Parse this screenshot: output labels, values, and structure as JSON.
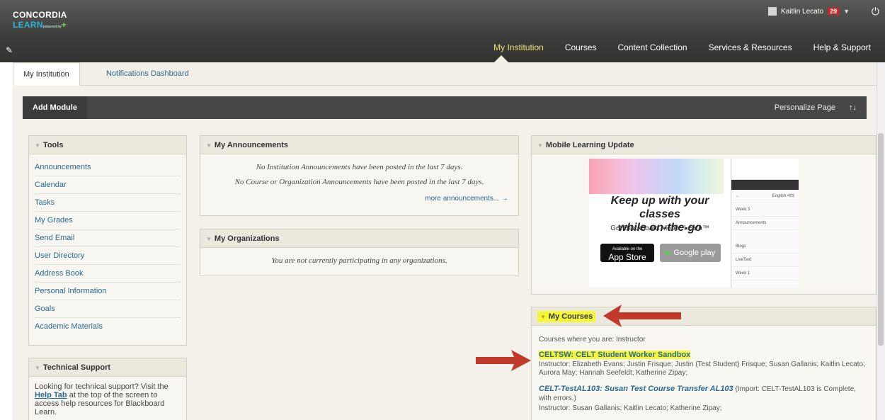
{
  "header": {
    "logo_line1": "CONCORDIA",
    "logo_line2": "LEARN",
    "logo_small": "powered by",
    "user_name": "Kaitlin Lecato",
    "notification_count": "29",
    "nav": [
      "My Institution",
      "Courses",
      "Content Collection",
      "Services & Resources",
      "Help & Support"
    ],
    "active_nav": "My Institution"
  },
  "subtabs": [
    "My Institution",
    "Notifications Dashboard"
  ],
  "module_bar": {
    "add": "Add Module",
    "personalize": "Personalize Page",
    "sort": "↑↓"
  },
  "tools": {
    "title": "Tools",
    "items": [
      "Announcements",
      "Calendar",
      "Tasks",
      "My Grades",
      "Send Email",
      "User Directory",
      "Address Book",
      "Personal Information",
      "Goals",
      "Academic Materials"
    ]
  },
  "tech_support": {
    "title": "Technical Support",
    "text_before": "Looking for technical support? Visit the ",
    "link": "Help Tab",
    "text_after": " at the top of the screen to access help resources for Blackboard Learn."
  },
  "announcements": {
    "title": "My Announcements",
    "line1": "No Institution Announcements have been posted in the last 7 days.",
    "line2": "No Course or Organization Announcements have been posted in the last 7 days.",
    "more": "more announcements... →"
  },
  "organizations": {
    "title": "My Organizations",
    "text": "You are not currently participating in any organizations."
  },
  "mobile": {
    "title": "Mobile Learning Update",
    "headline1": "Keep up with your classes",
    "headline2": "while on-the-go",
    "sub": "Get Blackboard Mobile Learn™",
    "appstore_small": "Available on the",
    "appstore": "App Store",
    "googleplay": "Google play",
    "phone_header": "English 403",
    "phone_items": [
      "Week 3",
      "Announcements",
      "Blogs",
      "LiveText",
      "Week 1"
    ]
  },
  "my_courses": {
    "title": "My Courses",
    "role_line": "Courses where you are: Instructor",
    "course1_title": "CELTSW: CELT Student Worker Sandbox",
    "course1_instr_label": "Instructor:",
    "course1_instr": "Elizabeth Evans;  Justin Frisque;  Justin (Test Student) Frisque;  Susan Gallanis;  Kaitlin Lecato;  Aurora May;  Hannah Seefeldt;  Katherine Zipay;",
    "course2_title": "CELT-TestAL103: Susan Test Course Transfer AL103",
    "course2_note": "(Import: CELT-TestAL103 is Complete, with errors.)",
    "course2_instr_label": "Instructor:",
    "course2_instr": "Susan Gallanis;  Kaitlin Lecato;  Katherine Zipay;"
  },
  "colors": {
    "accent": "#2b6a8f",
    "highlight": "#f5f53a",
    "arrow": "#c0392b",
    "header": "#3c3c3a"
  }
}
